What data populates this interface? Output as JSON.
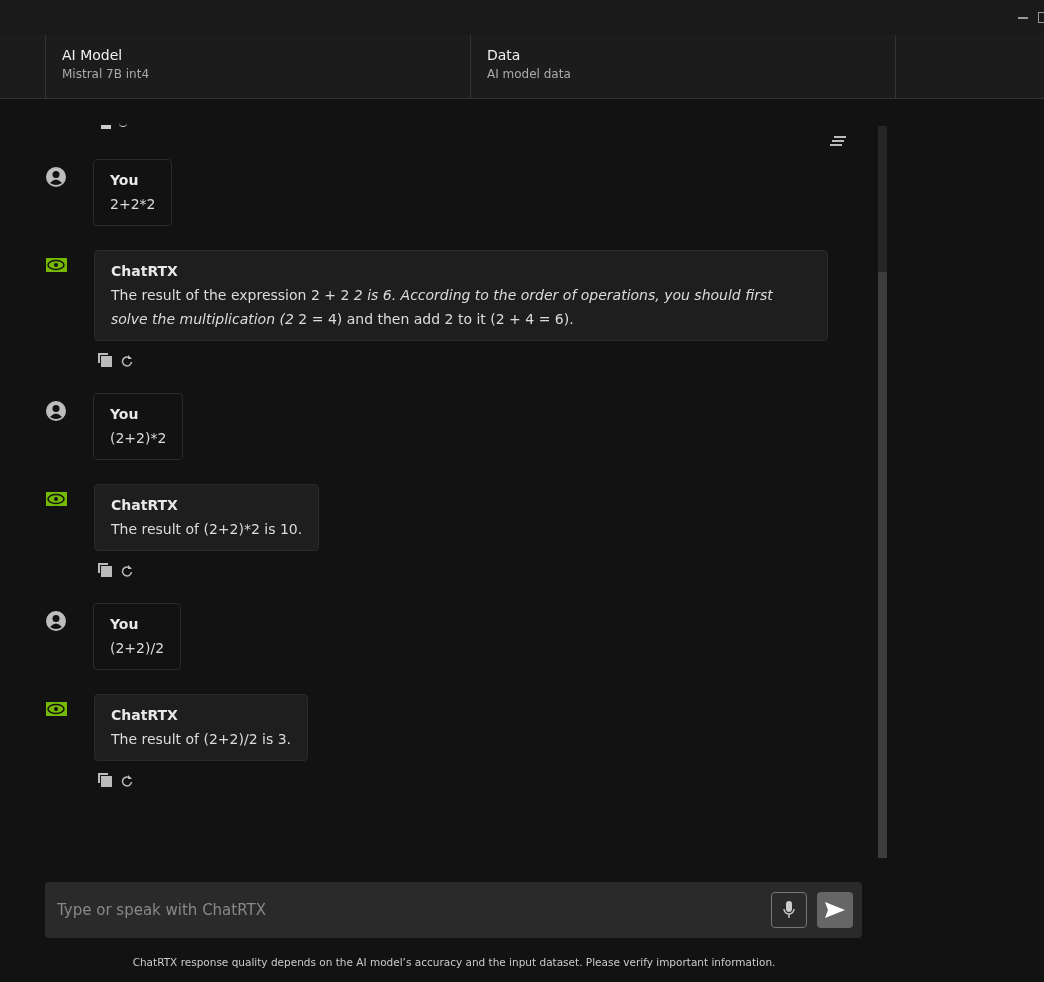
{
  "header": {
    "tabs": [
      {
        "title": "AI Model",
        "value": "Mistral 7B int4"
      },
      {
        "title": "Data",
        "value": "AI model data"
      }
    ]
  },
  "messages": [
    {
      "kind": "user",
      "sender": "You",
      "text": "2+2*2"
    },
    {
      "kind": "assistant",
      "sender": "ChatRTX",
      "text": "The result of the expression 2 + 2 *2 is 6. According to the order of operations, you should first solve the multiplication (2* 2 = 4) and then add 2 to it (2 + 4 = 6)."
    },
    {
      "kind": "user",
      "sender": "You",
      "text": "(2+2)*2"
    },
    {
      "kind": "assistant",
      "sender": "ChatRTX",
      "text": "The result of (2+2)*2 is 10."
    },
    {
      "kind": "user",
      "sender": "You",
      "text": "(2+2)/2"
    },
    {
      "kind": "assistant",
      "sender": "ChatRTX",
      "text": "The result of (2+2)/2 is 3."
    }
  ],
  "input": {
    "placeholder": "Type or speak with ChatRTX"
  },
  "footer": "ChatRTX response quality depends on the AI model’s accuracy and the input dataset. Please verify important information."
}
